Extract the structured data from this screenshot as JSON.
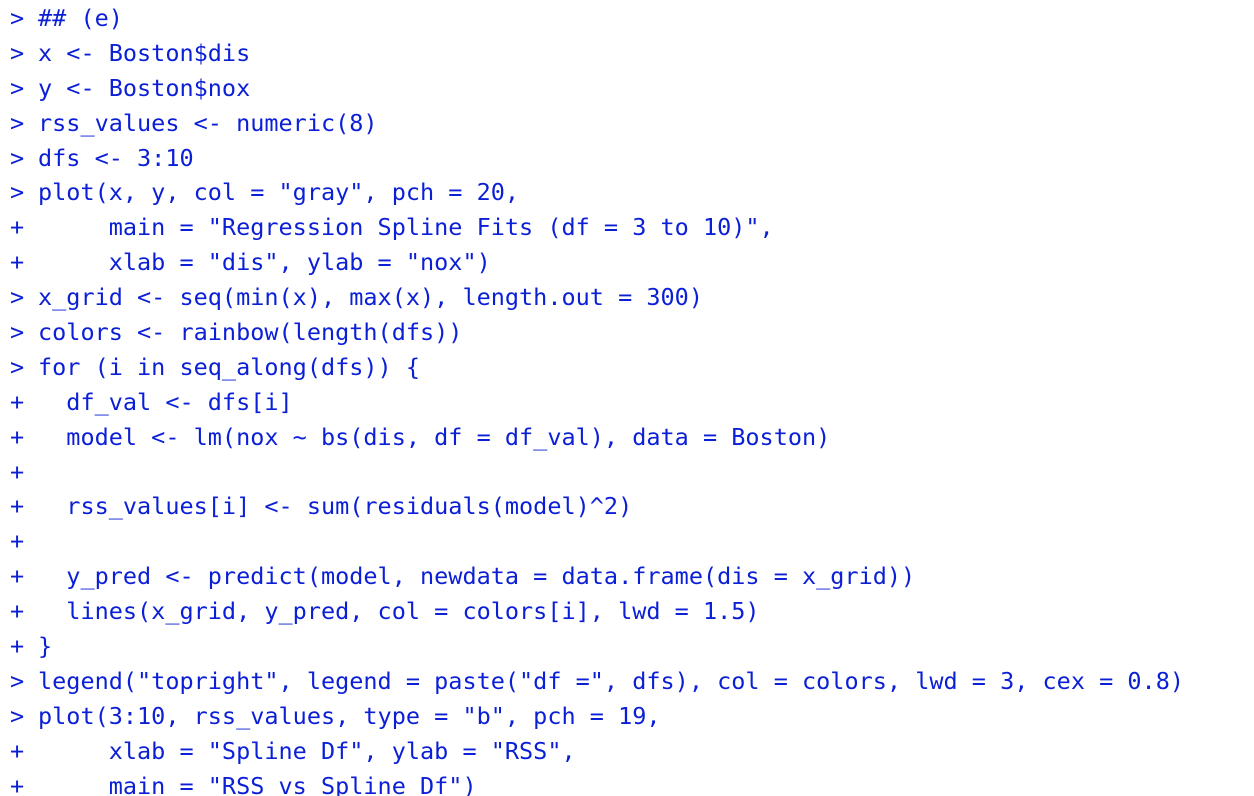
{
  "console": {
    "lines": [
      {
        "prompt": ">",
        "code": "## (e)"
      },
      {
        "prompt": ">",
        "code": "x <- Boston$dis"
      },
      {
        "prompt": ">",
        "code": "y <- Boston$nox"
      },
      {
        "prompt": ">",
        "code": "rss_values <- numeric(8)"
      },
      {
        "prompt": ">",
        "code": "dfs <- 3:10"
      },
      {
        "prompt": ">",
        "code": "plot(x, y, col = \"gray\", pch = 20,"
      },
      {
        "prompt": "+",
        "code": "     main = \"Regression Spline Fits (df = 3 to 10)\","
      },
      {
        "prompt": "+",
        "code": "     xlab = \"dis\", ylab = \"nox\")"
      },
      {
        "prompt": ">",
        "code": "x_grid <- seq(min(x), max(x), length.out = 300)"
      },
      {
        "prompt": ">",
        "code": "colors <- rainbow(length(dfs))"
      },
      {
        "prompt": ">",
        "code": "for (i in seq_along(dfs)) {"
      },
      {
        "prompt": "+",
        "code": "  df_val <- dfs[i]"
      },
      {
        "prompt": "+",
        "code": "  model <- lm(nox ~ bs(dis, df = df_val), data = Boston)"
      },
      {
        "prompt": "+",
        "code": ""
      },
      {
        "prompt": "+",
        "code": "  rss_values[i] <- sum(residuals(model)^2)"
      },
      {
        "prompt": "+",
        "code": ""
      },
      {
        "prompt": "+",
        "code": "  y_pred <- predict(model, newdata = data.frame(dis = x_grid))"
      },
      {
        "prompt": "+",
        "code": "  lines(x_grid, y_pred, col = colors[i], lwd = 1.5)"
      },
      {
        "prompt": "+",
        "code": "}"
      },
      {
        "prompt": ">",
        "code": "legend(\"topright\", legend = paste(\"df =\", dfs), col = colors, lwd = 3, cex = 0.8)"
      },
      {
        "prompt": ">",
        "code": "plot(3:10, rss_values, type = \"b\", pch = 19,"
      },
      {
        "prompt": "+",
        "code": "     xlab = \"Spline Df\", ylab = \"RSS\","
      },
      {
        "prompt": "+",
        "code": "     main = \"RSS vs Spline Df\")"
      }
    ]
  },
  "colors": {
    "text": "#0b1fd6",
    "background": "#ffffff"
  }
}
